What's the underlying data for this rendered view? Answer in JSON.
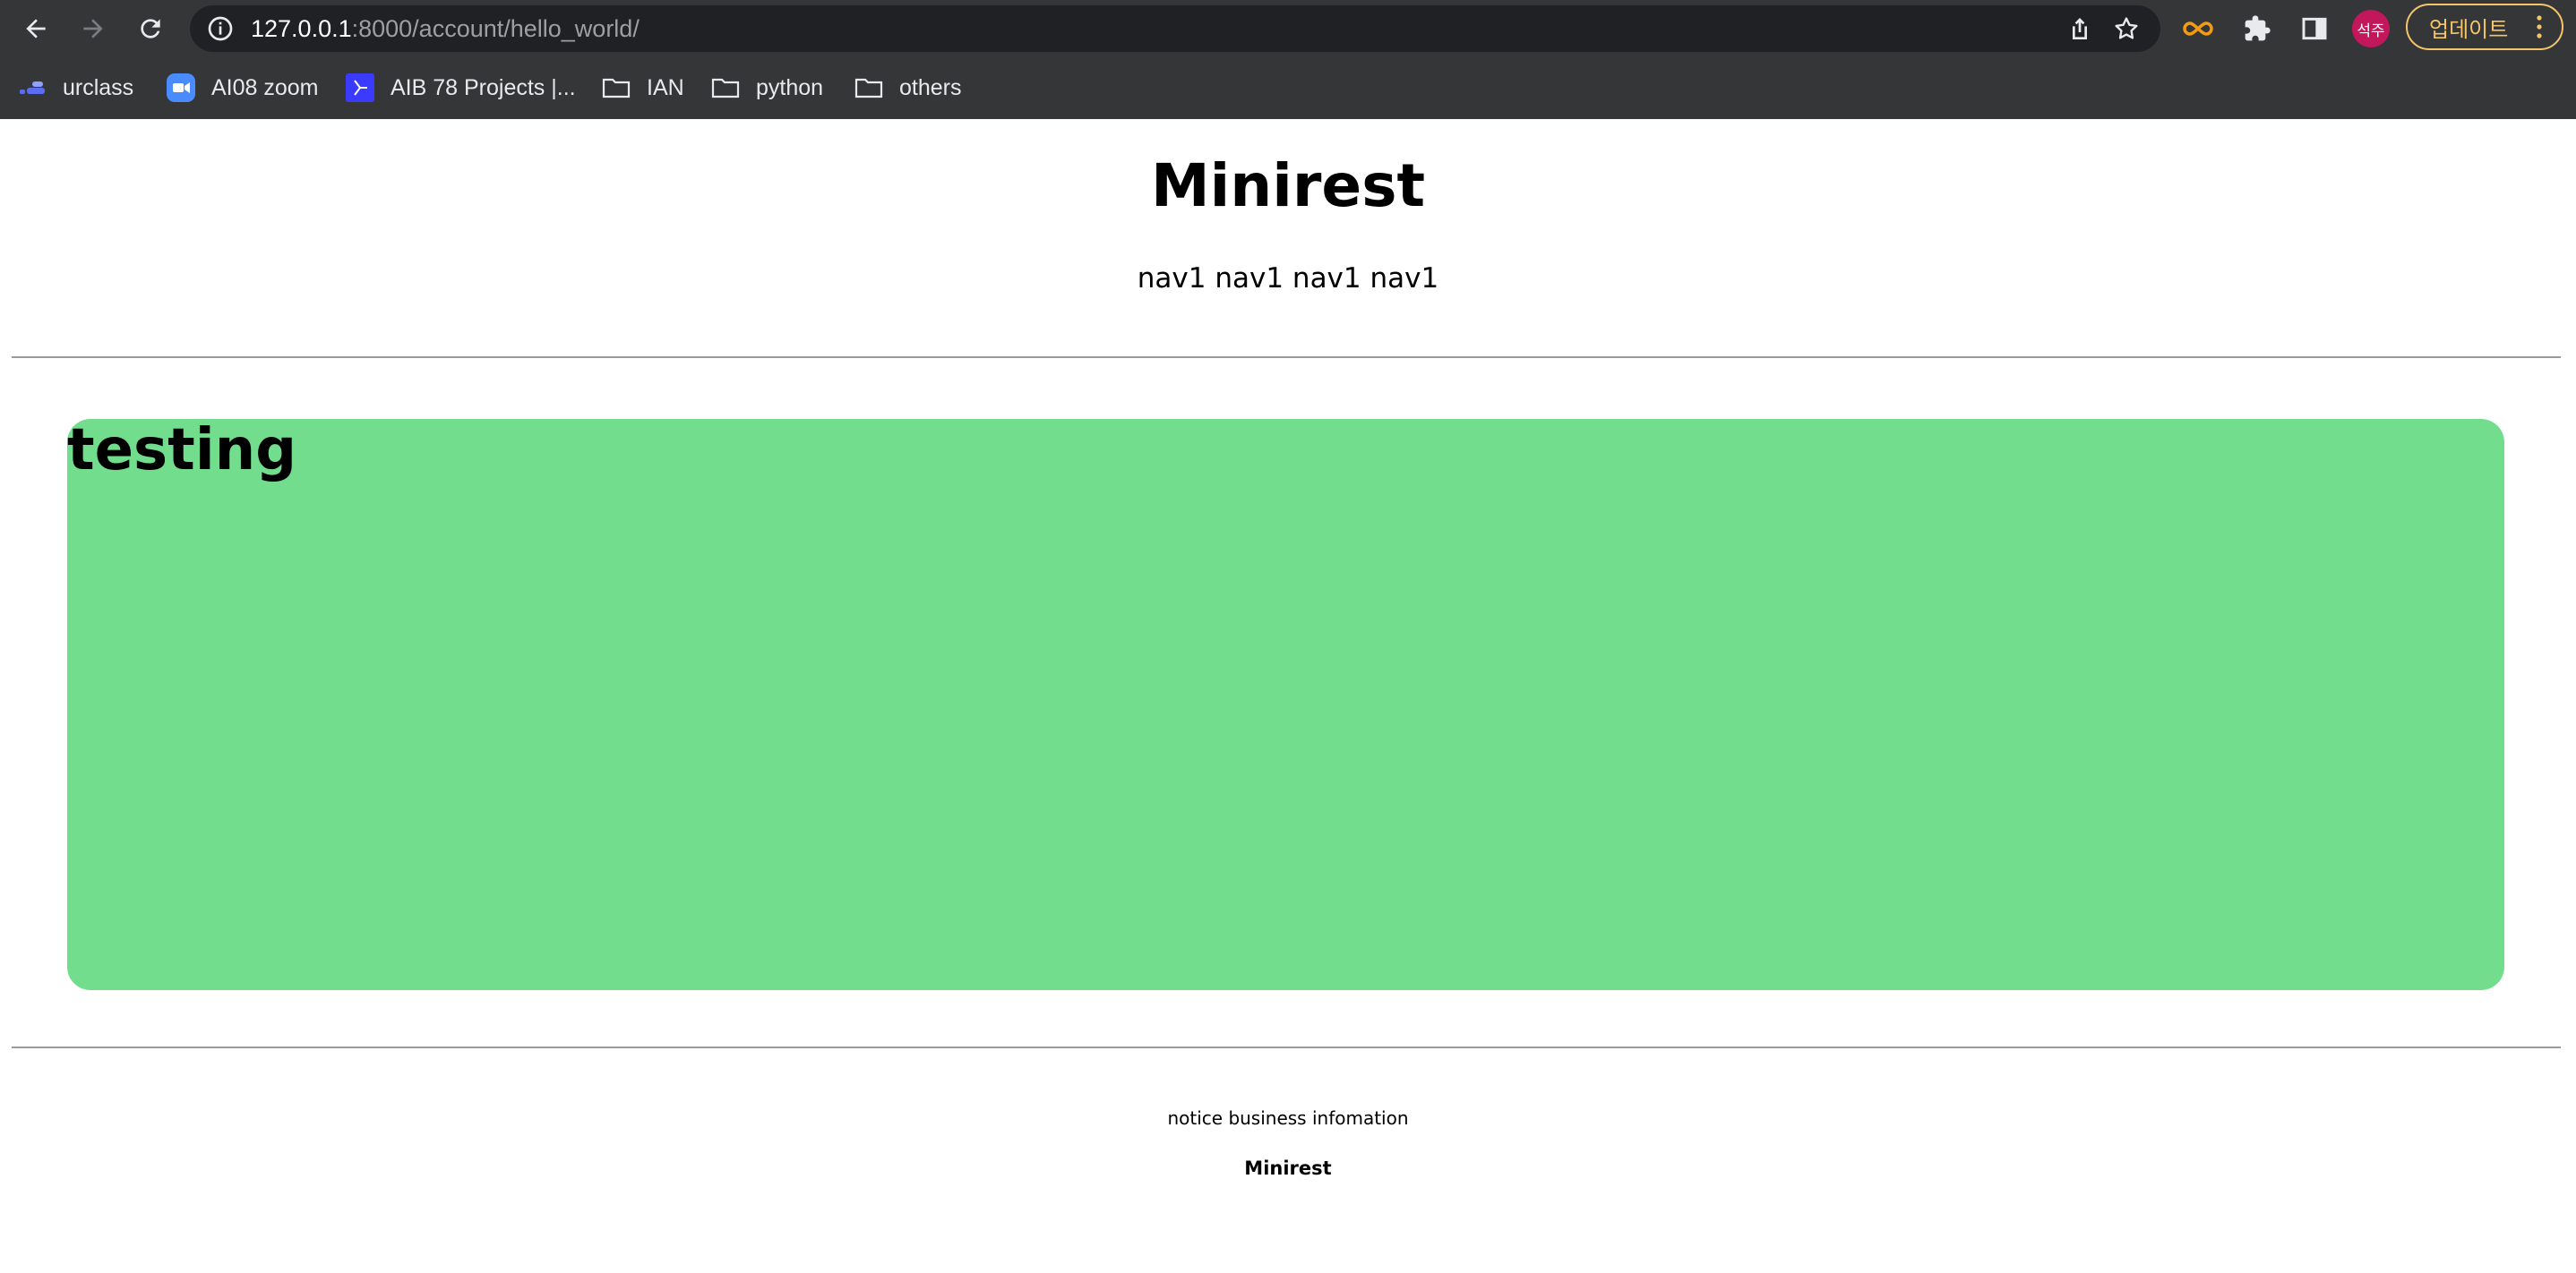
{
  "browser": {
    "address_bar": {
      "host": "127.0.0.1",
      "path": ":8000/account/hello_world/"
    },
    "profile_avatar_text": "석주",
    "update_button_label": "업데이트",
    "bookmarks": [
      {
        "label": "urclass",
        "icon": "urclass-icon"
      },
      {
        "label": "AI08 zoom",
        "icon": "zoom-icon"
      },
      {
        "label": "AIB 78 Projects |...",
        "icon": "projects-icon"
      },
      {
        "label": "IAN",
        "icon": "folder-icon"
      },
      {
        "label": "python",
        "icon": "folder-icon"
      },
      {
        "label": "others",
        "icon": "folder-icon"
      }
    ]
  },
  "header": {
    "title": "Minirest",
    "nav": "nav1 nav1 nav1 nav1"
  },
  "main": {
    "card_title": "testing",
    "card_color": "#72dd8c"
  },
  "footer": {
    "notice": "notice business infomation",
    "brand": "Minirest"
  }
}
